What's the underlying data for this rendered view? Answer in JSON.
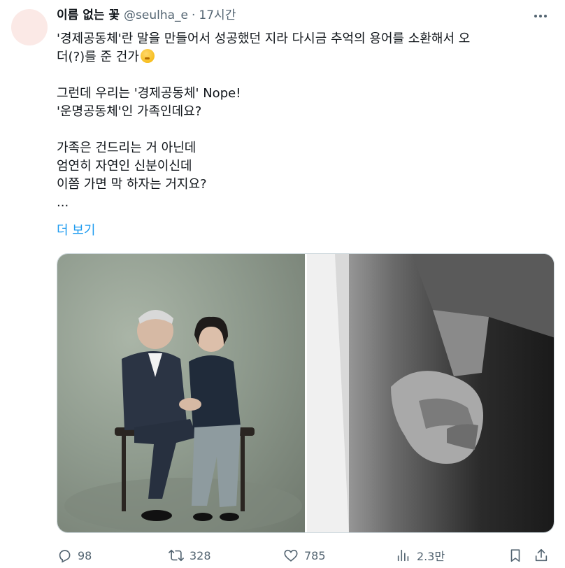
{
  "tweet": {
    "author_name": "이름 없는 꽃",
    "handle": "@seulha_e",
    "separator": "·",
    "time": "17시간",
    "lines": [
      "'경제공동체'란 말을 만들어서 성공했던 지라 다시금 추억의 용어를 소환해서 오",
      "더(?)를 준 건가",
      "",
      "그런데 우리는 '경제공동체' Nope!",
      "'운명공동체'인 가족인데요?",
      "",
      "가족은 건드리는 거 아닌데",
      "엄연히 자연인 신분이신데",
      "이쯤 가면 막 하자는 거지요?",
      "..."
    ],
    "show_more": "더 보기"
  },
  "icons": {
    "more": "more-horizontal-icon",
    "emoji": "thinking-face-emoji",
    "reply": "reply-icon",
    "retweet": "retweet-icon",
    "like": "heart-icon",
    "views": "views-chart-icon",
    "bookmark": "bookmark-icon",
    "share": "share-icon"
  },
  "media": {
    "left": "couple-seated-portrait",
    "right": "holding-hands-bw-photo"
  },
  "stats": {
    "replies": "98",
    "retweets": "328",
    "likes": "785",
    "views": "2.3만"
  },
  "colors": {
    "text": "#0f1419",
    "muted": "#536471",
    "link": "#1d9bf0"
  }
}
